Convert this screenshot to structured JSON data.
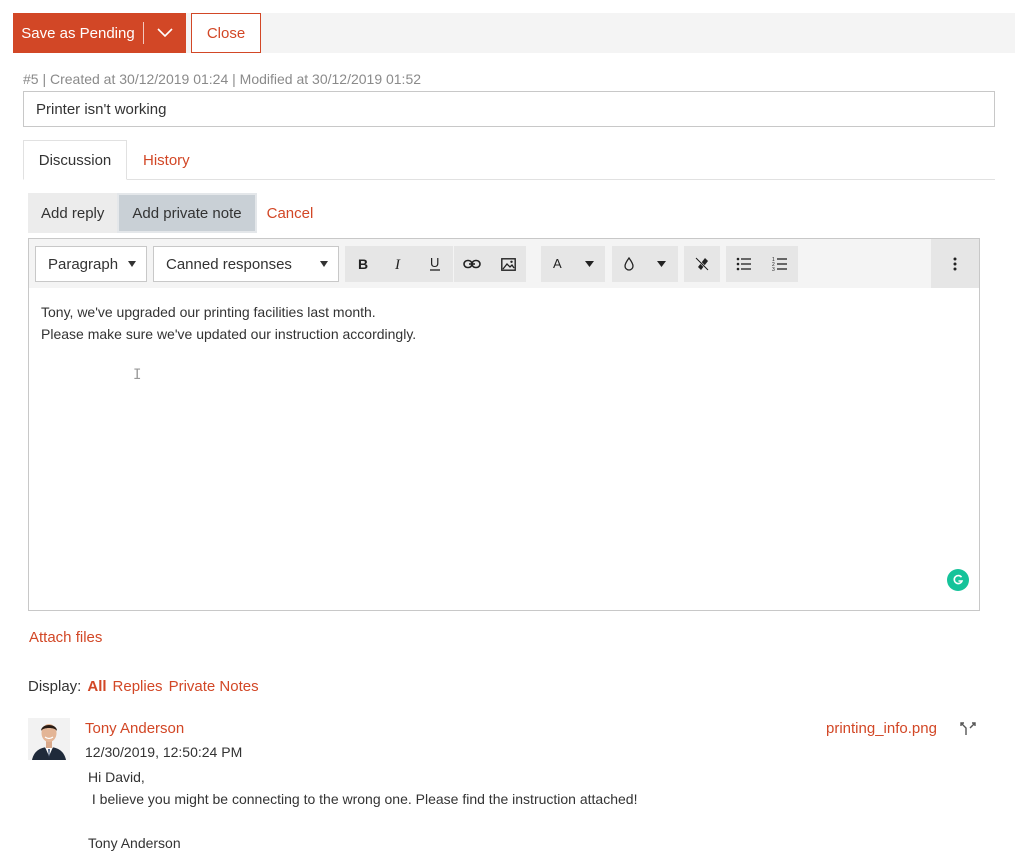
{
  "toolbar": {
    "save_label": "Save as Pending",
    "close_label": "Close"
  },
  "ticket": {
    "meta": "#5 | Created at 30/12/2019 01:24 | Modified at 30/12/2019 01:52",
    "subject": "Printer isn't working"
  },
  "tabs": [
    {
      "label": "Discussion",
      "active": true
    },
    {
      "label": "History",
      "active": false
    }
  ],
  "reply_bar": {
    "add_reply": "Add reply",
    "add_private_note": "Add private note",
    "cancel": "Cancel"
  },
  "editor": {
    "format_select": "Paragraph",
    "canned_select": "Canned responses",
    "icons": [
      "bold-icon",
      "italic-icon",
      "underline-icon",
      "link-icon",
      "image-icon",
      "font-color-icon",
      "highlight-color-icon",
      "clear-format-icon",
      "bullet-list-icon",
      "numbered-list-icon",
      "more-options-icon"
    ],
    "lines": [
      "Tony, we've upgraded our printing facilities last month.",
      "Please make sure we've updated our instruction accordingly."
    ]
  },
  "attach_files": "Attach files",
  "display_filter": {
    "label": "Display:",
    "options": [
      "All",
      "Replies",
      "Private Notes"
    ],
    "active": "All"
  },
  "message": {
    "author": "Tony Anderson",
    "timestamp": "12/30/2019, 12:50:24 PM",
    "body": "Hi David,\n I believe you might be connecting to the wrong one. Please find the instruction attached!\n\nTony Anderson",
    "attachment": "printing_info.png"
  },
  "colors": {
    "accent": "#d24726",
    "grammarly": "#15c39a"
  }
}
